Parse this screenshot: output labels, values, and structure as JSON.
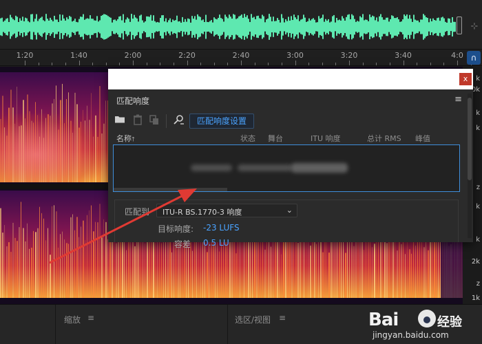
{
  "colors": {
    "waveform": "#5ee8b0",
    "accent": "#4aa3ff",
    "close": "#c0392b",
    "arrow": "#e03a33",
    "focus_border": "#3f8fdc"
  },
  "timeline": {
    "ticks": [
      "1:20",
      "1:40",
      "2:00",
      "2:20",
      "2:40",
      "3:00",
      "3:20",
      "3:40",
      "4:0"
    ],
    "button_icon": "headphones-icon"
  },
  "frequency_scale": {
    "labels": [
      "k",
      "0k",
      "k",
      "k",
      "z",
      "k",
      "k",
      "2k",
      "1k",
      "z"
    ]
  },
  "dialog": {
    "close_label": "x",
    "panel_title": "匹配响度",
    "menu_glyph": "≡",
    "toolbar": {
      "settings_button": "匹配响度设置",
      "icons": [
        "folder-icon",
        "trash-icon",
        "copy-icon",
        "loudness-scan-icon"
      ]
    },
    "columns": {
      "name": "名称",
      "sort_glyph": "🡑",
      "status": "状态",
      "stage": "舞台",
      "itu": "ITU 响度",
      "rms": "总计 RMS",
      "peak": "峰值"
    },
    "match": {
      "label": "匹配到",
      "standard": "ITU-R BS.1770-3 响度",
      "target_label": "目标响度:",
      "target_value": "-23 LUFS",
      "tolerance_label": "容差",
      "tolerance_value": "0.5 LU"
    }
  },
  "bottom_panels": {
    "zoom": "缩放",
    "selection_view": "选区/视图",
    "menu_glyph": "≡"
  },
  "watermark": {
    "logo_text": "Bai",
    "logo_suffix": "经验",
    "url": "jingyan.baidu.com"
  }
}
